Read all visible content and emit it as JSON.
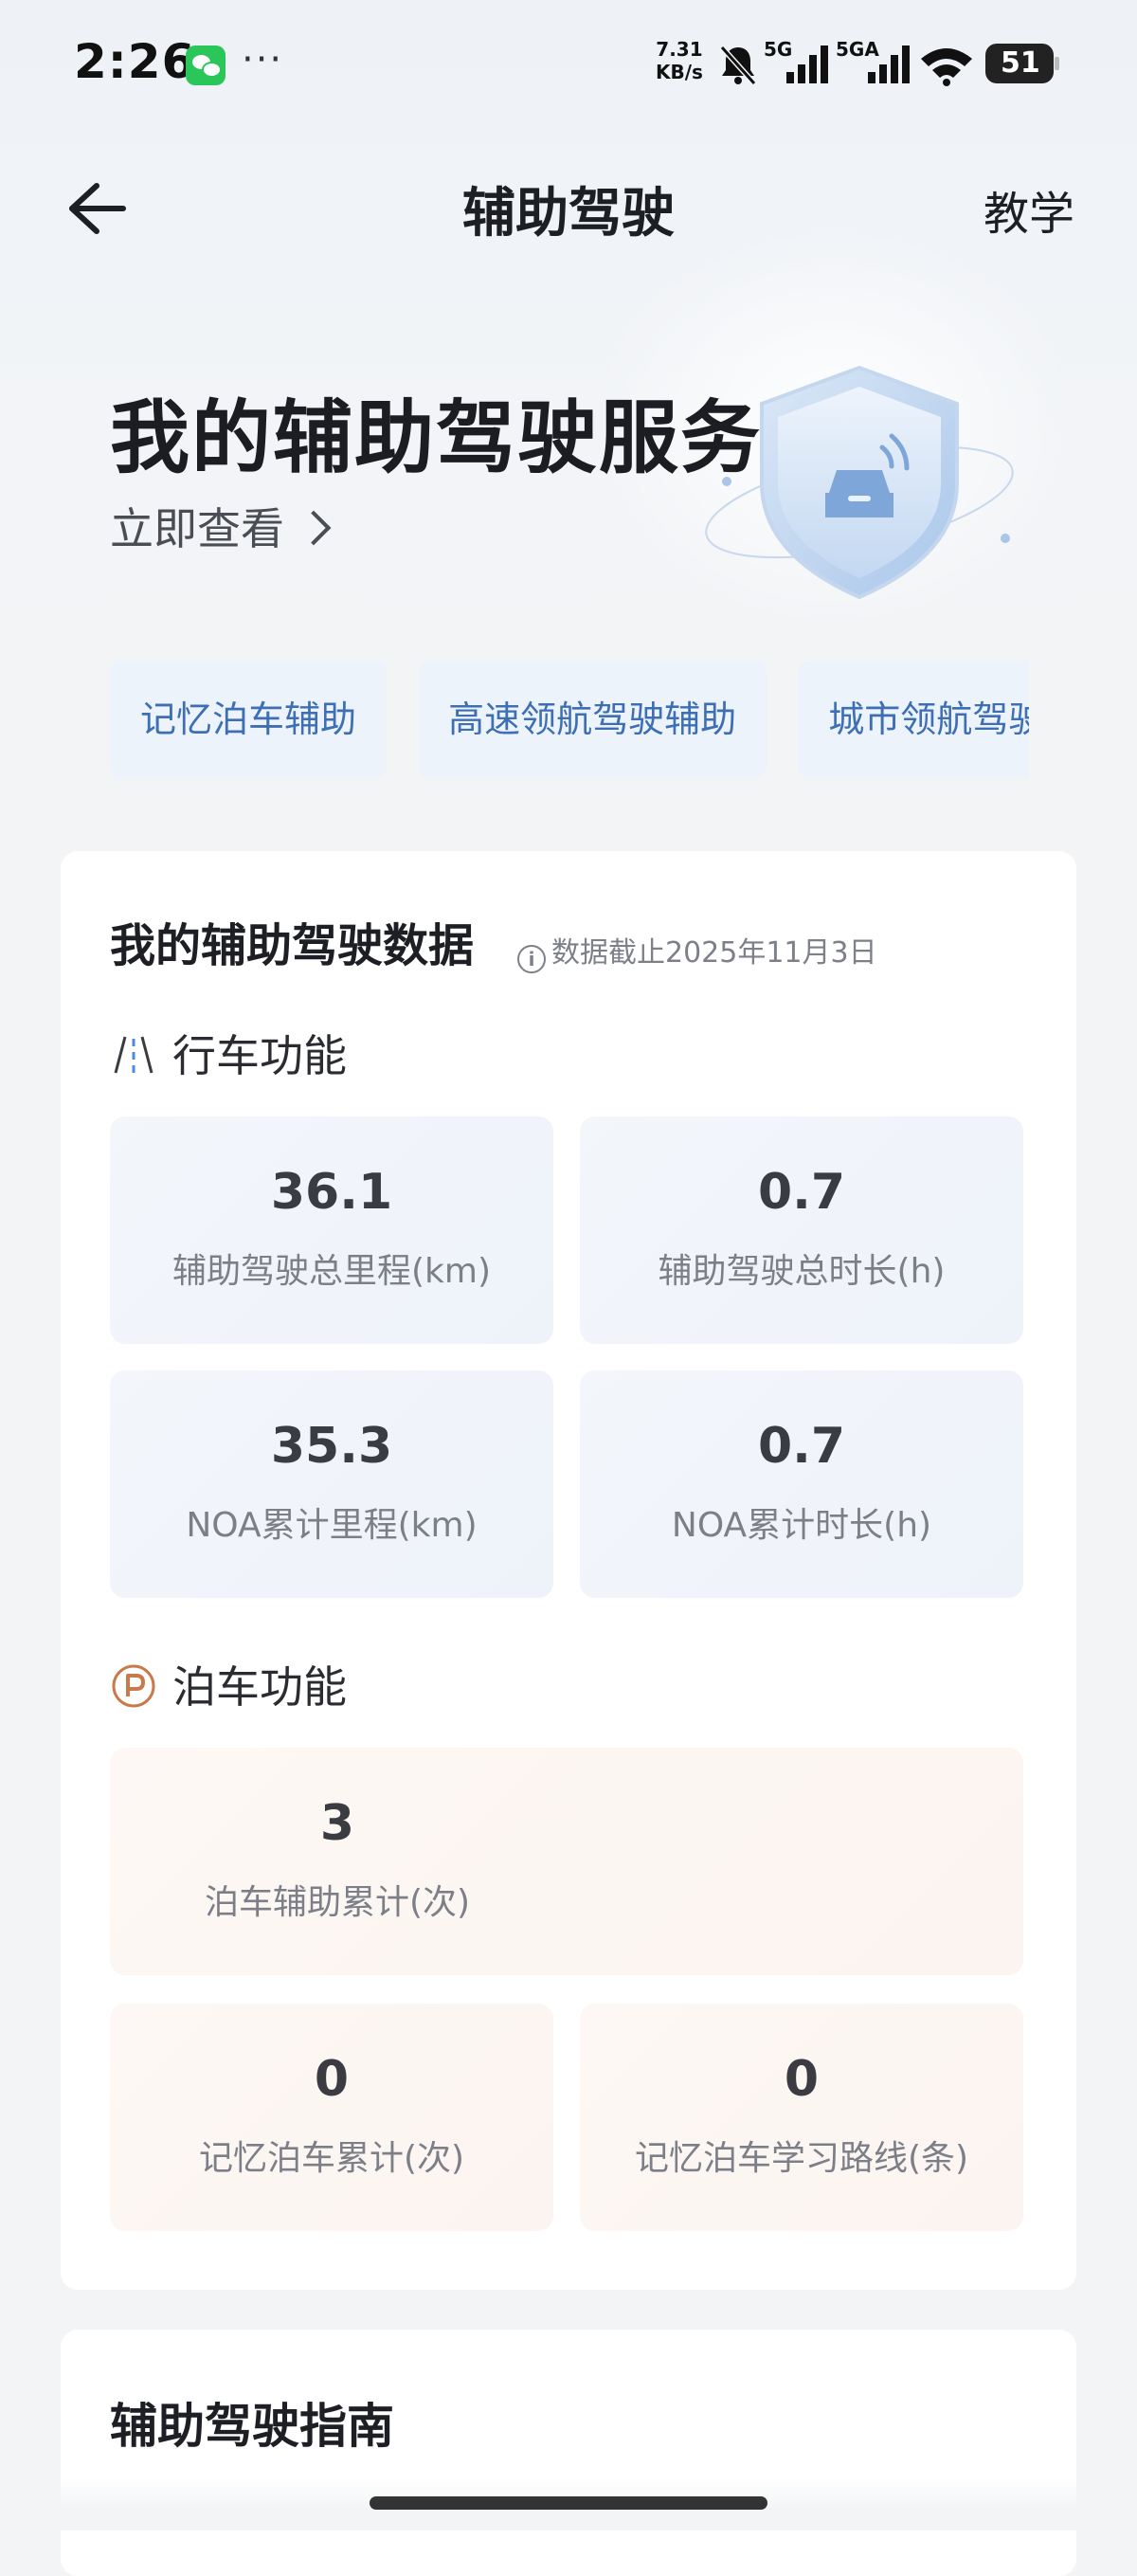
{
  "status_bar": {
    "time": "2:26",
    "more": "···",
    "net_speed_value": "7.31",
    "net_speed_unit": "KB/s",
    "signal1_label": "5G",
    "signal2_label": "5GA",
    "battery": "51"
  },
  "header": {
    "title": "辅助驾驶",
    "right_action": "教学"
  },
  "hero": {
    "title": "我的辅助驾驶服务",
    "link": "立即查看"
  },
  "chips": [
    "记忆泊车辅助",
    "高速领航驾驶辅助",
    "城市领航驾驶辅助"
  ],
  "data_card": {
    "title": "我的辅助驾驶数据",
    "note": "数据截止2025年11月3日",
    "driving": {
      "label": "行车功能",
      "stats": [
        {
          "value": "36.1",
          "label": "辅助驾驶总里程(km)"
        },
        {
          "value": "0.7",
          "label": "辅助驾驶总时长(h)"
        },
        {
          "value": "35.3",
          "label": "NOA累计里程(km)"
        },
        {
          "value": "0.7",
          "label": "NOA累计时长(h)"
        }
      ]
    },
    "parking": {
      "label": "泊车功能",
      "stats": [
        {
          "value": "3",
          "label": "泊车辅助累计(次)"
        },
        {
          "value": "0",
          "label": "记忆泊车累计(次)"
        },
        {
          "value": "0",
          "label": "记忆泊车学习路线(条)"
        }
      ]
    }
  },
  "guide_card": {
    "title": "辅助驾驶指南"
  },
  "colors": {
    "accent_blue": "#3e6fb4",
    "chip_bg": "#edf3fb",
    "parking_icon": "#c97a4a"
  }
}
